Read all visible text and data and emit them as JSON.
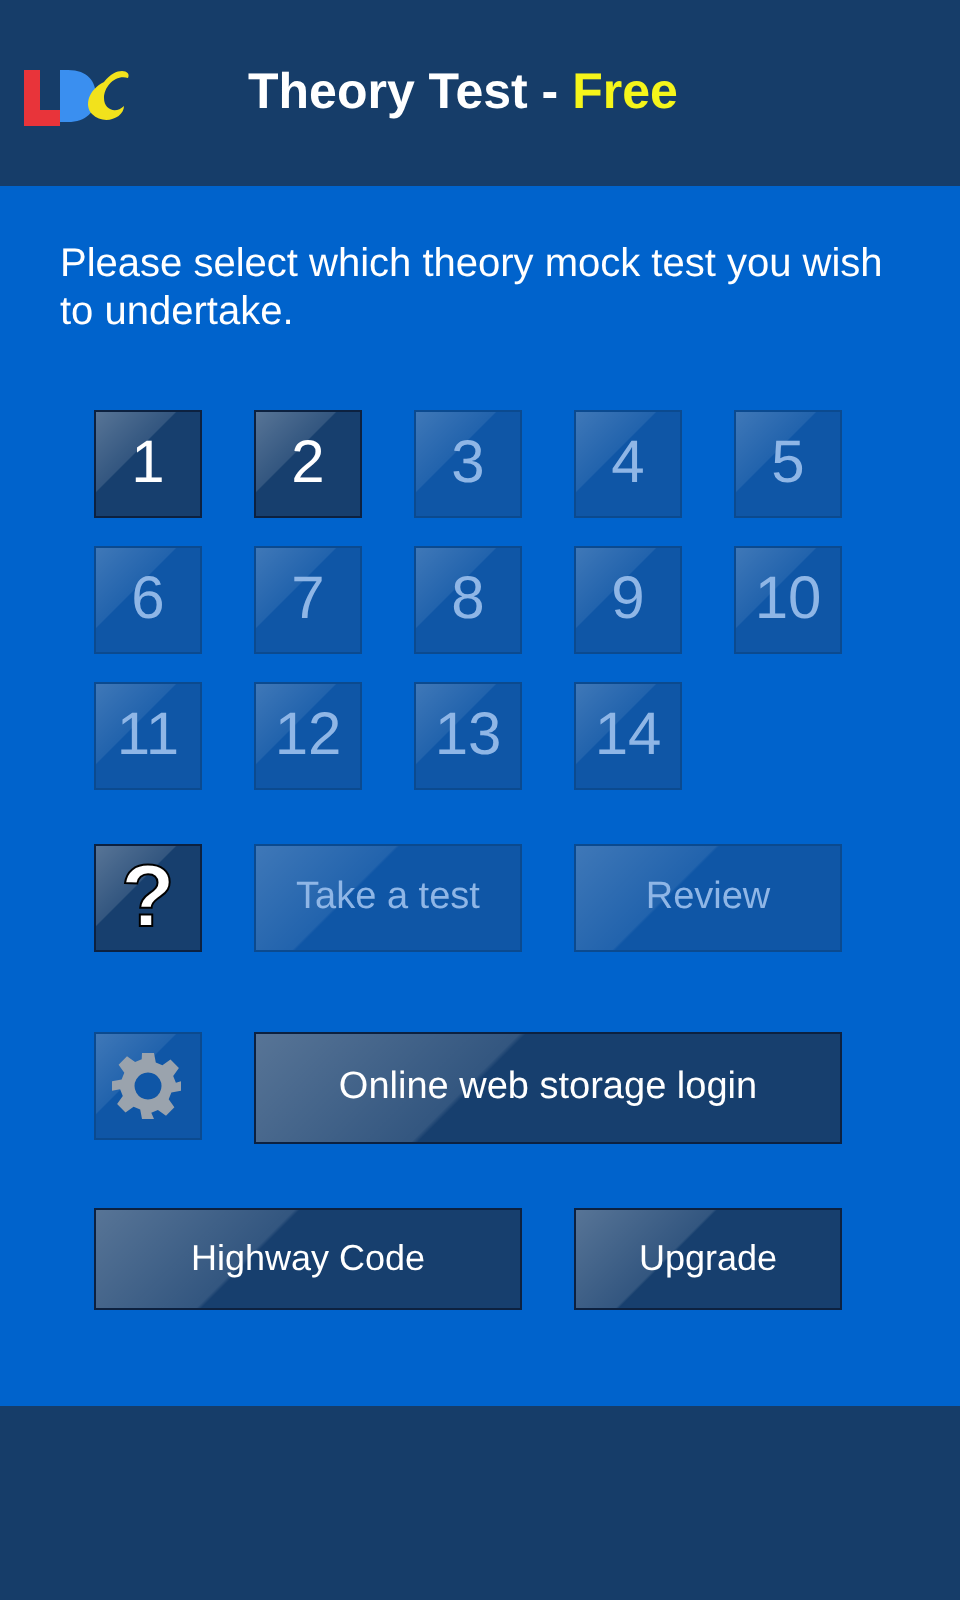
{
  "header": {
    "title": "Theory Test - ",
    "edition": "Free"
  },
  "intro": "Please select which theory mock test you wish to undertake.",
  "tests": [
    {
      "label": "1",
      "disabled": false
    },
    {
      "label": "2",
      "disabled": false
    },
    {
      "label": "3",
      "disabled": true
    },
    {
      "label": "4",
      "disabled": true
    },
    {
      "label": "5",
      "disabled": true
    },
    {
      "label": "6",
      "disabled": true
    },
    {
      "label": "7",
      "disabled": true
    },
    {
      "label": "8",
      "disabled": true
    },
    {
      "label": "9",
      "disabled": true
    },
    {
      "label": "10",
      "disabled": true
    },
    {
      "label": "11",
      "disabled": true
    },
    {
      "label": "12",
      "disabled": true
    },
    {
      "label": "13",
      "disabled": true
    },
    {
      "label": "14",
      "disabled": true
    }
  ],
  "actions": [
    {
      "kind": "help",
      "label": "?",
      "disabled": false
    },
    {
      "kind": "text",
      "label": "Take a test",
      "disabled": true
    },
    {
      "kind": "text",
      "label": "Review",
      "disabled": true
    }
  ],
  "storage": [
    {
      "kind": "gear",
      "disabled": true
    },
    {
      "kind": "text",
      "label": "Online web storage login",
      "disabled": false
    }
  ],
  "footer_buttons": [
    {
      "label": "Highway Code",
      "disabled": false
    },
    {
      "label": "Upgrade",
      "disabled": false
    }
  ]
}
